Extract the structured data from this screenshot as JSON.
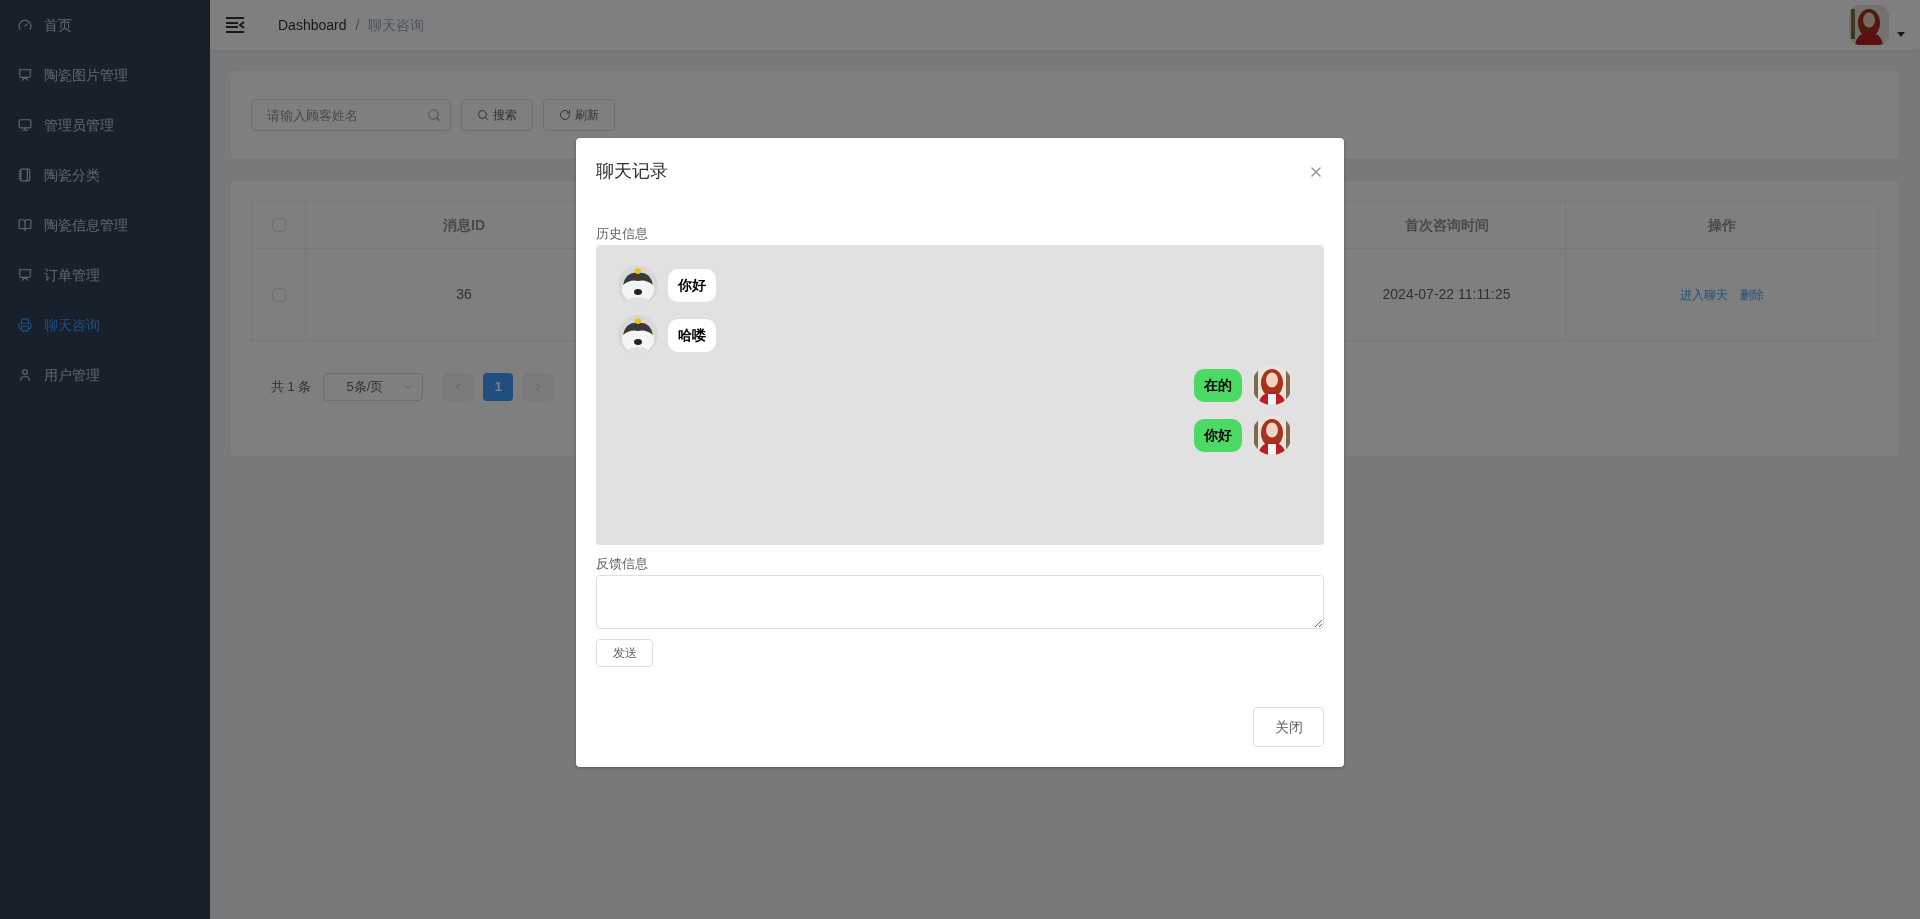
{
  "sidebar": {
    "items": [
      {
        "label": "首页",
        "selected": false
      },
      {
        "label": "陶瓷图片管理",
        "selected": false
      },
      {
        "label": "管理员管理",
        "selected": false
      },
      {
        "label": "陶瓷分类",
        "selected": false
      },
      {
        "label": "陶瓷信息管理",
        "selected": false
      },
      {
        "label": "订单管理",
        "selected": false
      },
      {
        "label": "聊天咨询",
        "selected": true
      },
      {
        "label": "用户管理",
        "selected": false
      }
    ]
  },
  "breadcrumb": [
    "Dashboard",
    "/",
    "聊天咨询"
  ],
  "search": {
    "placeholder": "请输入顾客姓名",
    "buttons": [
      {
        "label": "搜索",
        "kind": "search"
      },
      {
        "label": "刷新",
        "kind": "refresh"
      }
    ]
  },
  "table": {
    "columns": [
      "消息ID",
      "首次咨询时间",
      "操作"
    ],
    "rows": [
      {
        "checked": false,
        "id": "36",
        "time": "2024-07-22 11:11:25",
        "actions": [
          "进入聊天",
          "删除"
        ]
      }
    ],
    "header_checked": false
  },
  "pagination": {
    "total": "共 1 条",
    "page_size": "5条/页",
    "pages": [
      {
        "label": "1",
        "selected": true
      }
    ]
  },
  "dialog": {
    "title": "聊天记录",
    "history_label": "历史信息",
    "messages": [
      {
        "kind": "incoming",
        "text": "你好"
      },
      {
        "kind": "incoming",
        "text": "哈喽"
      },
      {
        "kind": "outgoing",
        "text": "在的"
      },
      {
        "kind": "outgoing",
        "text": "你好"
      }
    ],
    "feedback_label": "反馈信息",
    "send_button": "发送",
    "close_button": "关闭"
  }
}
